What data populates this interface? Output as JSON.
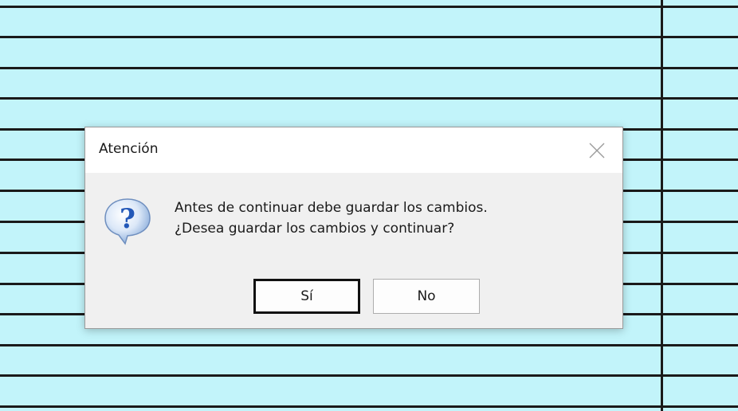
{
  "dialog": {
    "title": "Atención",
    "message_line1": "Antes de continuar debe guardar los cambios.",
    "message_line2": "¿Desea guardar los cambios y continuar?",
    "icon": "question-icon",
    "buttons": {
      "yes_label": "Sí",
      "no_label": "No"
    }
  },
  "colors": {
    "background": "#c2f4fa",
    "grid_lines": "#1a1a1a",
    "dialog_body": "#f0f0f0",
    "dialog_titlebar": "#ffffff",
    "icon_bubble": "#4a7fd0"
  }
}
